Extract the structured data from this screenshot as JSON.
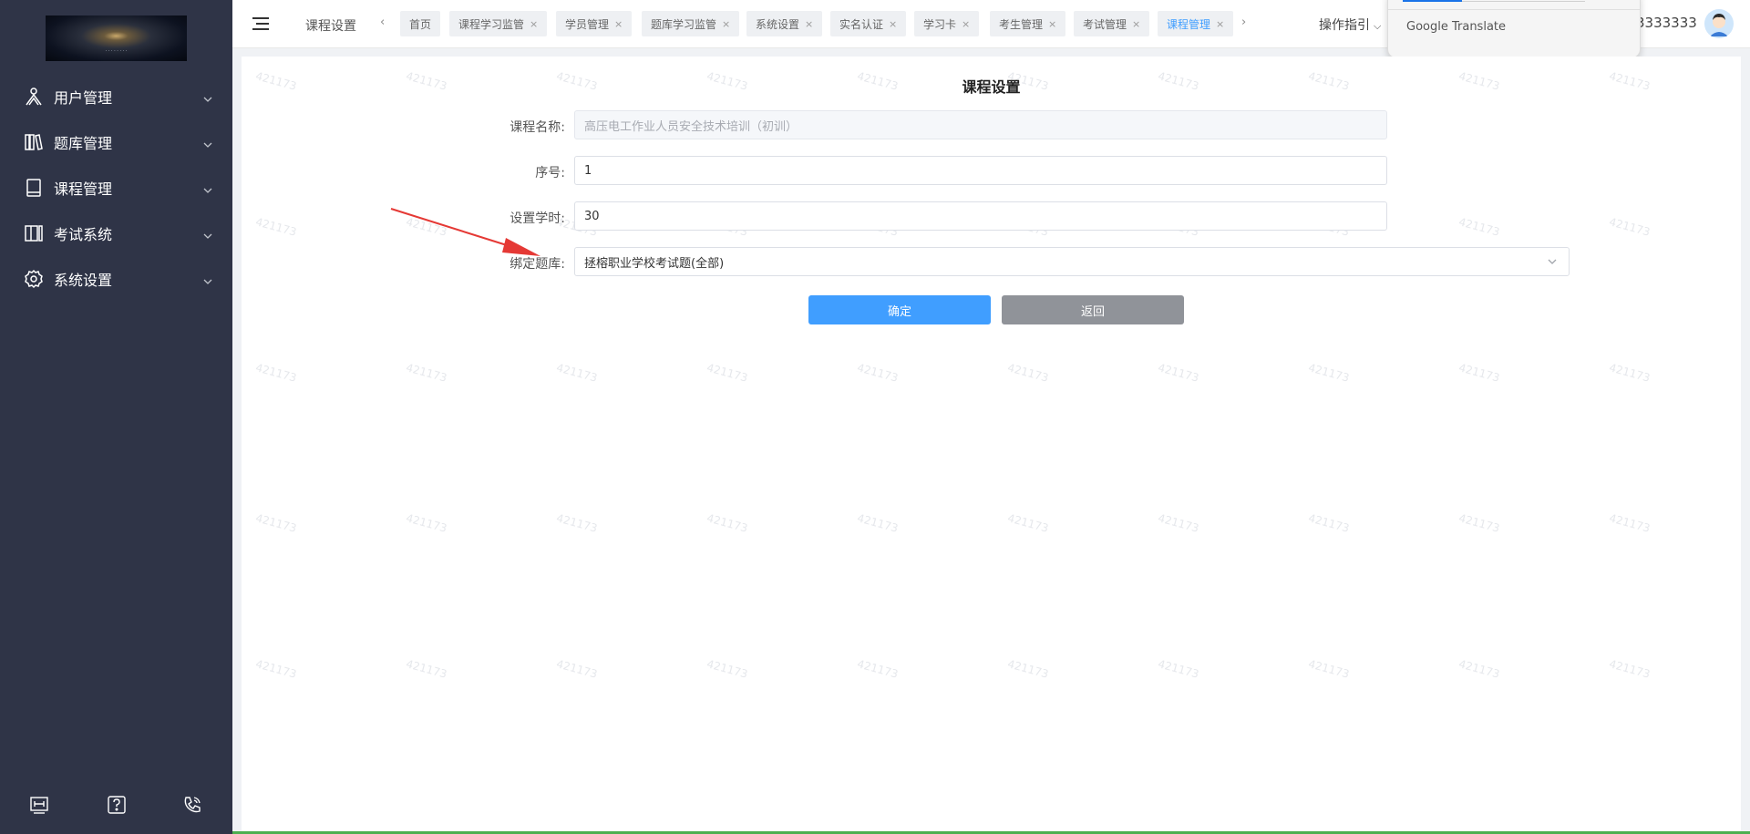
{
  "sidebar": {
    "logo_caption": "· · · · · · · ·",
    "items": [
      {
        "label": "用户管理",
        "icon": "users-icon"
      },
      {
        "label": "题库管理",
        "icon": "library-icon"
      },
      {
        "label": "课程管理",
        "icon": "book-icon"
      },
      {
        "label": "考试系统",
        "icon": "exam-icon"
      },
      {
        "label": "系统设置",
        "icon": "gear-icon"
      }
    ],
    "bottom_icons": [
      "fit-width-icon",
      "help-icon",
      "phone-icon"
    ]
  },
  "topbar": {
    "breadcrumb": "课程设置",
    "tabs": [
      {
        "label": "首页",
        "closable": false,
        "active": false
      },
      {
        "label": "课程学习监管",
        "closable": true,
        "active": false
      },
      {
        "label": "学员管理",
        "closable": true,
        "active": false
      },
      {
        "label": "题库学习监管",
        "closable": true,
        "active": false
      },
      {
        "label": "系统设置",
        "closable": true,
        "active": false
      },
      {
        "label": "实名认证",
        "closable": true,
        "active": false
      },
      {
        "label": "学习卡",
        "closable": true,
        "active": false
      },
      {
        "label": "考生管理",
        "closable": true,
        "active": false
      },
      {
        "label": "考试管理",
        "closable": true,
        "active": false
      },
      {
        "label": "课程管理",
        "closable": true,
        "active": true
      }
    ],
    "close_glyph": "×",
    "prev_glyph": "‹",
    "next_glyph": "›",
    "ops_label": "操作指引",
    "user_partial": "3333333"
  },
  "translate_popup": {
    "label": "Google Translate"
  },
  "form": {
    "title": "课程设置",
    "fields": [
      {
        "label": "课程名称:",
        "value": "高压电工作业人员安全技术培训（初训）",
        "disabled": true
      },
      {
        "label": "序号:",
        "value": "1",
        "disabled": false
      },
      {
        "label": "设置学时:",
        "value": "30",
        "disabled": false
      },
      {
        "label": "绑定题库:",
        "value": "拯榕职业学校考试题(全部)",
        "type": "select"
      }
    ],
    "confirm_label": "确定",
    "back_label": "返回"
  },
  "watermark_text": "421173",
  "colors": {
    "sidebar_bg": "#2f3447",
    "primary": "#409eff",
    "secondary_button": "#909399",
    "annotation_arrow": "#e53935"
  }
}
